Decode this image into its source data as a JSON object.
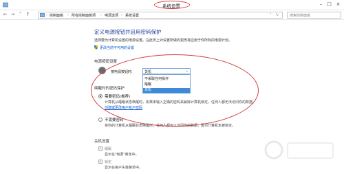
{
  "window": {
    "title": "系统设置"
  },
  "address": {
    "back": "←",
    "forward": "→",
    "up": "↑",
    "crumbs": [
      "控制面板",
      "所有控制面板项",
      "电源选项",
      "系统设置"
    ],
    "search_placeholder": "搜索控制面板"
  },
  "main": {
    "heading": "定义电源按钮并启用密码保护",
    "intro": "选择要为计算机设置的电源设置。在此页上对设置所做的更改将应用于你所有的电源计划。",
    "change_link": "更改当前不可用的设置",
    "power_section": {
      "title": "电源按钮设置",
      "button_label": "按电源按钮时:",
      "selected": "关机",
      "options": [
        "不采取任何操作",
        "睡眠",
        "关机"
      ]
    },
    "password_section": {
      "title": "唤醒时的密码保护",
      "require": {
        "title": "需要密码(推荐)",
        "desc1": "计算机从睡眠状态唤醒时，如果未输入正确的密码来解除计算机锁定，任何人都无法访问你的数据。",
        "link": "创建或更改用户帐户密码"
      },
      "no_require": {
        "title": "不需要密码",
        "desc": "将你的计算机从睡眠状态唤醒时，任何人都可以访问你的数据，因为计算机未被锁定。"
      }
    },
    "shutdown_section": {
      "title": "关机设置",
      "sleep_label": "睡眠",
      "sleep_desc": "显示在\"电源\"菜单中。",
      "lock_label": "锁定",
      "lock_desc": "显示在用户头像菜单中。"
    }
  },
  "colors": {
    "accent": "#1f3f99",
    "link": "#0a58ca",
    "annotation": "#d23c3c",
    "highlight": "#3c8ad8"
  },
  "icons": {
    "shield": "uac-shield-icon",
    "power": "power-button-icon",
    "control_panel": "control-panel-icon"
  }
}
